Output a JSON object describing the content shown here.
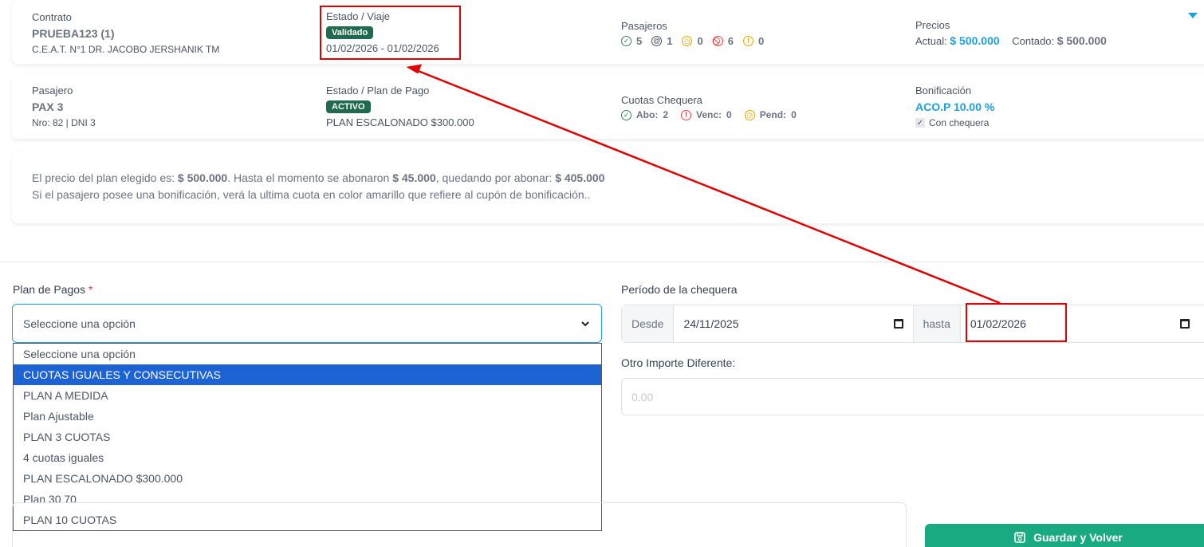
{
  "contrato": {
    "label": "Contrato",
    "codigo": "PRUEBA123 (1)",
    "escuela": "C.E.A.T. N°1 DR. JACOBO JERSHANIK TM"
  },
  "viaje": {
    "label": "Estado / Viaje",
    "estado": "Validado",
    "fechas": "01/02/2026 - 01/02/2026"
  },
  "pasajeros": {
    "label": "Pasajeros",
    "counts": [
      "5",
      "1",
      "0",
      "6",
      "0"
    ]
  },
  "precios": {
    "label": "Precios",
    "actual_label": "Actual:",
    "actual_value": "$ 500.000",
    "contado_label": "Contado:",
    "contado_value": "$ 500.000"
  },
  "pasajero": {
    "label": "Pasajero",
    "nombre": "PAX 3",
    "detalle": "Nro: 82 | DNI 3"
  },
  "plan_pago": {
    "label": "Estado / Plan de Pago",
    "estado": "ACTIVO",
    "plan": "PLAN ESCALONADO $300.000"
  },
  "cuotas": {
    "label": "Cuotas Chequera",
    "abo_label": "Abo:",
    "abo_value": "2",
    "venc_label": "Venc:",
    "venc_value": "0",
    "pend_label": "Pend:",
    "pend_value": "0"
  },
  "bonificacion": {
    "label": "Bonificación",
    "valor": "ACO.P 10.00 %",
    "check_label": "Con chequera"
  },
  "info": {
    "l1_a": "El precio del plan elegido es:",
    "l1_b": "$ 500.000",
    "l1_c": ". Hasta el momento se abonaron",
    "l1_d": "$ 45.000",
    "l1_e": ", quedando por abonar:",
    "l1_f": "$ 405.000",
    "l2": "Si el pasajero posee una bonificación, verá la ultima cuota en color amarillo que refiere al cupón de bonificación.."
  },
  "form": {
    "plan_label": "Plan de Pagos",
    "required_mark": "*",
    "plan_selected": "Seleccione una opción",
    "options": [
      "Seleccione una opción",
      "CUOTAS IGUALES Y CONSECUTIVAS",
      "PLAN A MEDIDA",
      "Plan Ajustable",
      "PLAN 3 CUOTAS",
      "4 cuotas iguales",
      "PLAN ESCALONADO $300.000",
      "Plan 30 70",
      "PLAN 10 CUOTAS"
    ],
    "periodo_label": "Período de la chequera",
    "desde_label": "Desde",
    "desde_value": "24/11/2025",
    "hasta_label": "hasta",
    "hasta_value": "01/02/2026",
    "otro_label": "Otro Importe Diferente:",
    "otro_placeholder": "0.00",
    "save_label": "Guardar y Volver"
  },
  "colors": {
    "accent": "#1ba1e2",
    "badge": "#1f6b4f",
    "save": "#1aaa82",
    "highlight": "#e00000",
    "selected_option": "#1e63d4"
  }
}
